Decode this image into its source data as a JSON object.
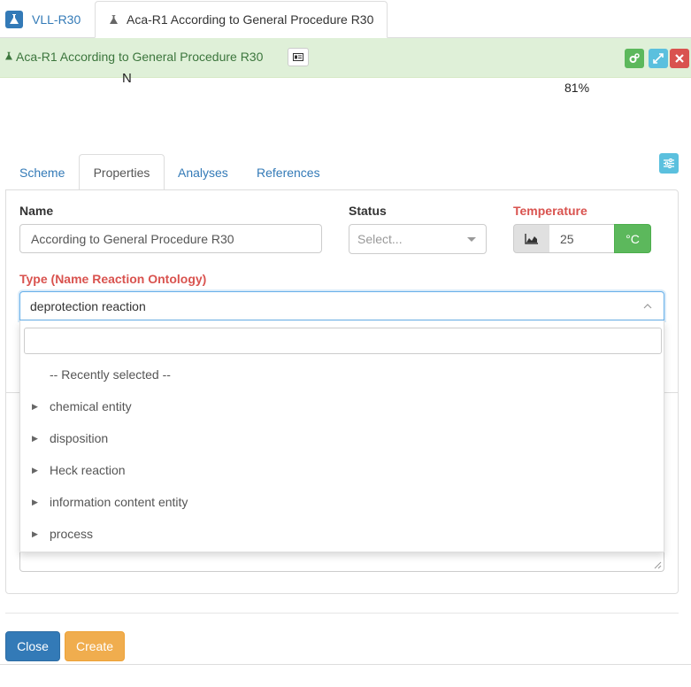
{
  "top_tabs": [
    {
      "label": "VLL-R30",
      "icon": "flask-icon"
    },
    {
      "label": "Aca-R1 According to General Procedure R30",
      "icon": "flask-icon"
    }
  ],
  "header": {
    "title": "Aca-R1 According to General Procedure R30",
    "colors": {
      "bg": "#dff0d8",
      "text": "#3c763d"
    }
  },
  "scheme": {
    "atom_label": "N",
    "yield": "81%"
  },
  "content_tabs": [
    {
      "label": "Scheme"
    },
    {
      "label": "Properties",
      "active": true
    },
    {
      "label": "Analyses"
    },
    {
      "label": "References"
    }
  ],
  "form": {
    "name_label": "Name",
    "name_value": "According to General Procedure R30",
    "status_label": "Status",
    "status_placeholder": "Select...",
    "temperature_label": "Temperature",
    "temperature_value": "25",
    "temperature_unit": "°C",
    "type_label": "Type (Name Reaction Ontology)",
    "type_value": "deprotection reaction"
  },
  "dropdown": {
    "search_value": "",
    "recent_header": "-- Recently selected --",
    "items": [
      {
        "label": "chemical entity"
      },
      {
        "label": "disposition"
      },
      {
        "label": "Heck reaction"
      },
      {
        "label": "information content entity"
      },
      {
        "label": "process"
      }
    ]
  },
  "footer": {
    "close_label": "Close",
    "create_label": "Create"
  },
  "colors": {
    "primary": "#337ab7",
    "success": "#5cb85c",
    "info": "#5bc0de",
    "danger": "#d9534f",
    "warning": "#f0ad4e"
  }
}
